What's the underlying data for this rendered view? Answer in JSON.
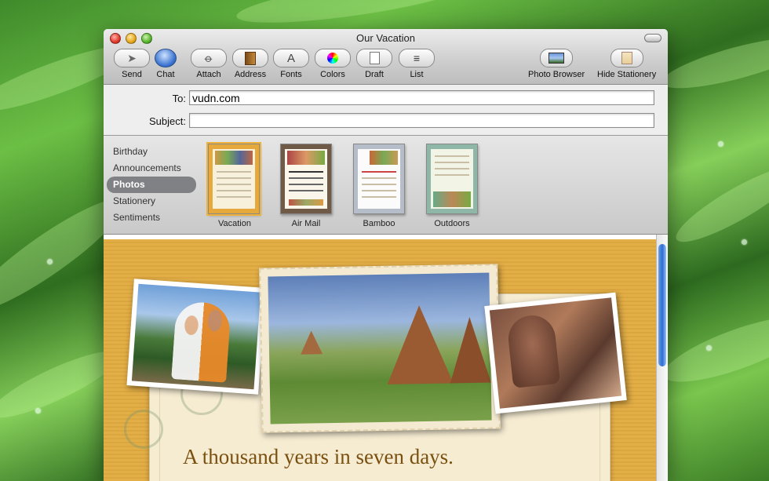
{
  "window": {
    "title": "Our Vacation"
  },
  "toolbar": {
    "items": [
      {
        "label": "Send",
        "icon": "paper-plane-icon"
      },
      {
        "label": "Chat",
        "icon": "chat-bubble-icon"
      },
      {
        "label": "Attach",
        "icon": "paperclip-icon"
      },
      {
        "label": "Address",
        "icon": "address-book-icon"
      },
      {
        "label": "Fonts",
        "icon": "fonts-icon"
      },
      {
        "label": "Colors",
        "icon": "color-wheel-icon"
      },
      {
        "label": "Draft",
        "icon": "draft-icon"
      },
      {
        "label": "List",
        "icon": "list-icon"
      }
    ],
    "right_items": [
      {
        "label": "Photo Browser",
        "icon": "photo-browser-icon"
      },
      {
        "label": "Hide Stationery",
        "icon": "stationery-icon"
      }
    ],
    "glyphs": {
      "fonts": "A",
      "list": "≡",
      "send": "➤",
      "attach": "⌀"
    }
  },
  "headers": {
    "to_label": "To:",
    "to_value": "vudn.com",
    "subject_label": "Subject:",
    "subject_value": ""
  },
  "stationery": {
    "categories": [
      "Birthday",
      "Announcements",
      "Photos",
      "Stationery",
      "Sentiments"
    ],
    "selected_category": "Photos",
    "templates": [
      "Vacation",
      "Air Mail",
      "Bamboo",
      "Outdoors"
    ],
    "selected_template": "Vacation"
  },
  "message": {
    "headline": "A thousand years in seven days."
  },
  "colors": {
    "accent": "#2f6cd0",
    "stationery_gold": "#e2ae46",
    "headline": "#7a5010"
  }
}
